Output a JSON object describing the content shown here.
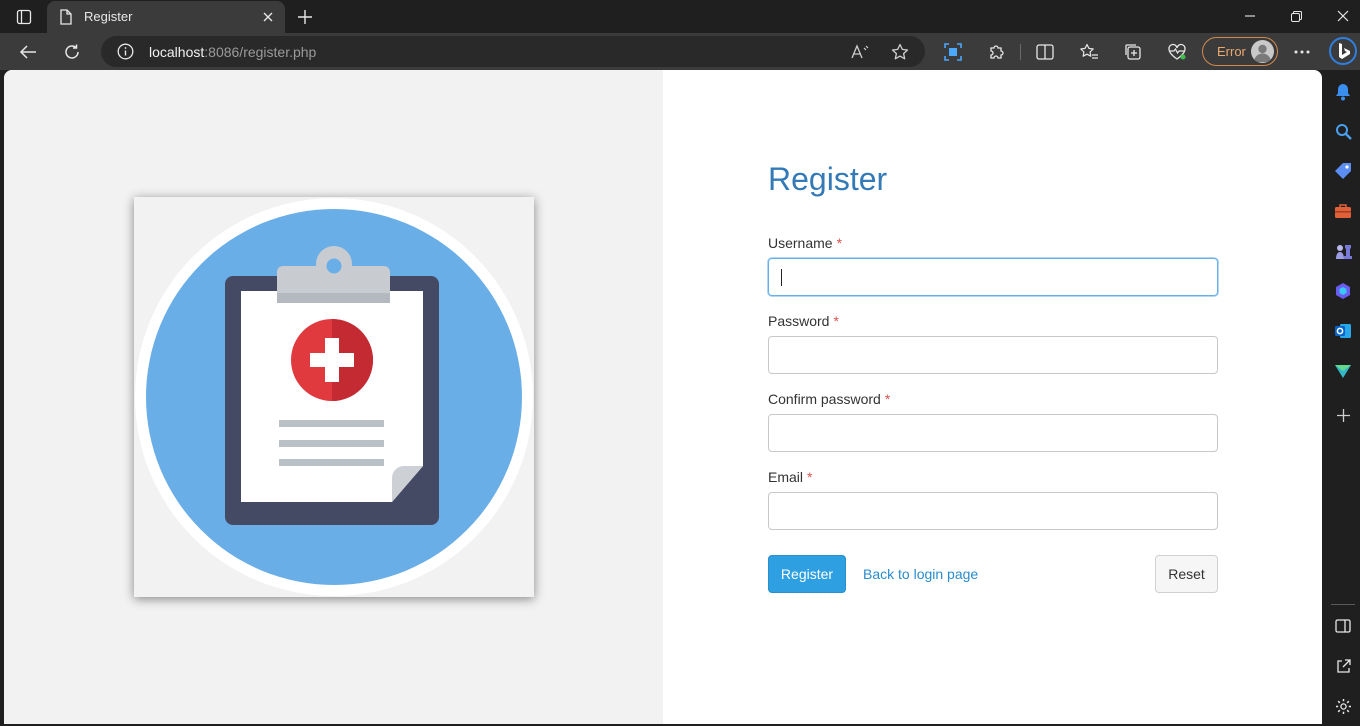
{
  "tab": {
    "title": "Register"
  },
  "address": {
    "host": "localhost",
    "rest": ":8086/register.php"
  },
  "profile": {
    "status": "Error"
  },
  "form": {
    "title": "Register",
    "username_label": "Username",
    "password_label": "Password",
    "confirm_label": "Confirm password",
    "email_label": "Email",
    "required_mark": "*",
    "username_value": "",
    "password_value": "",
    "confirm_value": "",
    "email_value": "",
    "register_button": "Register",
    "back_link": "Back to login page",
    "reset_button": "Reset"
  },
  "colors": {
    "title": "#337ab7",
    "primary_button": "#2e9fe0",
    "required": "#d9534f",
    "link": "#2a8ccc",
    "illustration_circle": "#6aaee8"
  }
}
